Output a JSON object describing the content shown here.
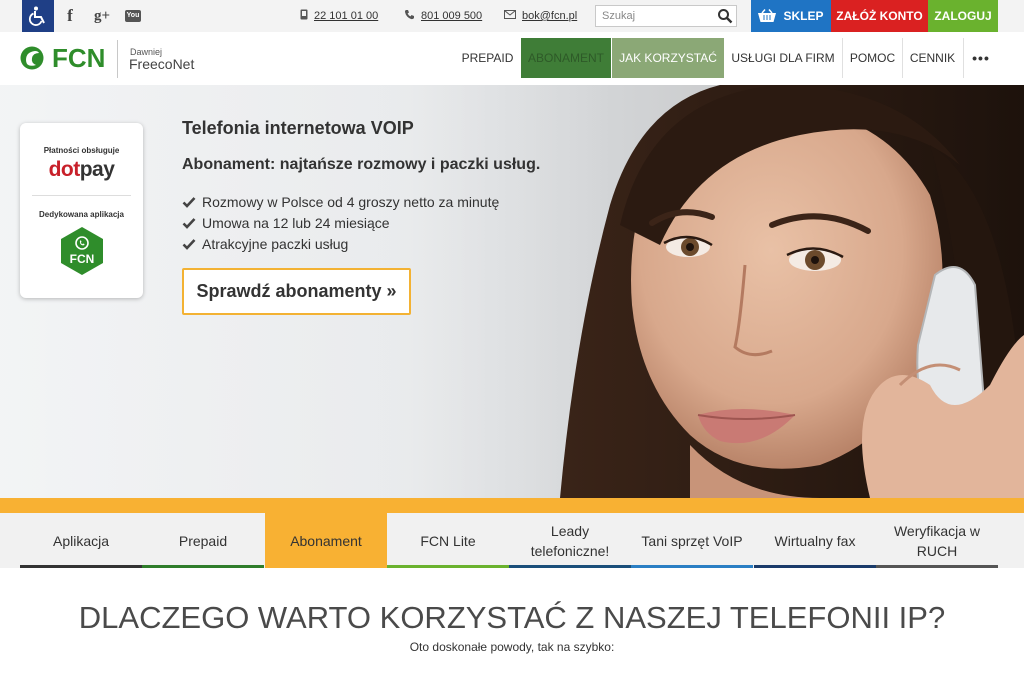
{
  "topbar": {
    "social": [
      {
        "name": "accessibility-icon"
      },
      {
        "name": "facebook-icon",
        "glyph": "f"
      },
      {
        "name": "google-plus-icon",
        "glyph": "g+"
      },
      {
        "name": "youtube-icon",
        "glyph": "You"
      }
    ],
    "phone1": "22 101 01 00",
    "phone2": "801 009 500",
    "email": "bok@fcn.pl",
    "search_placeholder": "Szukaj",
    "shop": "SKLEP",
    "register": "ZAŁÓŻ KONTO",
    "login": "ZALOGUJ"
  },
  "header": {
    "logo_text": "FCN",
    "logo_small": "Dawniej",
    "logo_brand": "FreecoNet",
    "nav": {
      "prepaid": "PREPAID",
      "abonament": "ABONAMENT",
      "jak": "JAK KORZYSTAĆ",
      "uslugi": "USŁUGI DLA FIRM",
      "pomoc": "POMOC",
      "cennik": "CENNIK",
      "more": "•••"
    }
  },
  "hero": {
    "badge_pay_label": "Płatności obsługuje",
    "dotpay_dot": "dot",
    "dotpay_pay": "pay",
    "badge_app_label": "Dedykowana aplikacja",
    "app_hex_text": "FCN",
    "title": "Telefonia internetowa VOIP",
    "subtitle": "Abonament: najtańsze rozmowy i paczki usług.",
    "features": [
      "Rozmowy w Polsce od 4 groszy netto za minutę",
      "Umowa na 12 lub 24 miesiące",
      "Atrakcyjne paczki usług"
    ],
    "cta": "Sprawdź abonamenty »"
  },
  "tabs": [
    {
      "label": "Aplikacja",
      "color": "#333333"
    },
    {
      "label": "Prepaid",
      "color": "#2f7d2b"
    },
    {
      "label": "Abonament",
      "color": "#f8b133"
    },
    {
      "label": "FCN Lite",
      "color": "#6ab22e"
    },
    {
      "label": "Leady telefoniczne!",
      "color": "#1a4f7a"
    },
    {
      "label": "Tani sprzęt VoIP",
      "color": "#2b7fc4"
    },
    {
      "label": "Wirtualny fax",
      "color": "#1a3b6a"
    },
    {
      "label": "Weryfikacja w RUCH",
      "color": "#555555"
    }
  ],
  "section": {
    "title": "DLACZEGO WARTO KORZYSTAĆ Z NASZEJ TELEFONII IP?",
    "subtitle": "Oto doskonałe powody, tak na szybko:"
  },
  "colors": {
    "brand_green": "#2f8d2b",
    "accent_yellow": "#f8b133",
    "shop_blue": "#1f74c4",
    "register_red": "#da2121",
    "login_green": "#6ab22e"
  }
}
